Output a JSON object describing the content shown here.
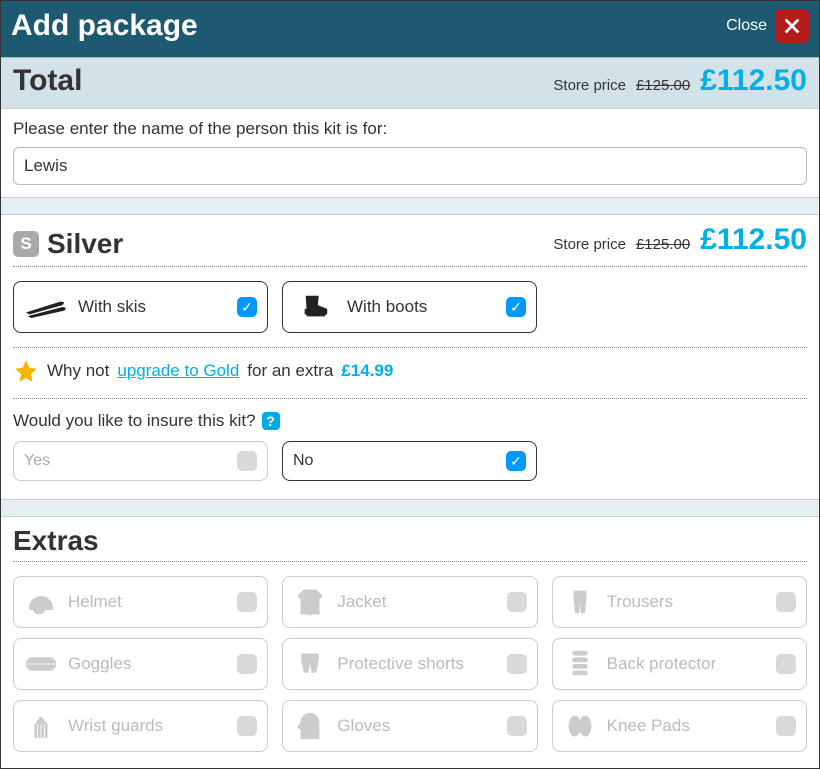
{
  "header": {
    "title": "Add package",
    "close_label": "Close"
  },
  "total": {
    "label": "Total",
    "store_label": "Store price",
    "old_price": "£125.00",
    "price": "£112.50"
  },
  "name_prompt": "Please enter the name of the person this kit is for:",
  "name_value": "Lewis",
  "silver": {
    "badge": "S",
    "title": "Silver",
    "store_label": "Store price",
    "old_price": "£125.00",
    "price": "£112.50",
    "options": [
      {
        "label": "With skis",
        "checked": true
      },
      {
        "label": "With boots",
        "checked": true
      }
    ],
    "upgrade_pre": "Why not ",
    "upgrade_link": "upgrade to Gold",
    "upgrade_mid": " for an extra ",
    "upgrade_price": "£14.99"
  },
  "insure": {
    "question": "Would you like to insure this kit?",
    "yes_label": "Yes",
    "no_label": "No"
  },
  "extras": {
    "title": "Extras",
    "items": [
      {
        "label": "Helmet"
      },
      {
        "label": "Jacket"
      },
      {
        "label": "Trousers"
      },
      {
        "label": "Goggles"
      },
      {
        "label": "Protective shorts"
      },
      {
        "label": "Back protector"
      },
      {
        "label": "Wrist guards"
      },
      {
        "label": "Gloves"
      },
      {
        "label": "Knee Pads"
      }
    ]
  }
}
